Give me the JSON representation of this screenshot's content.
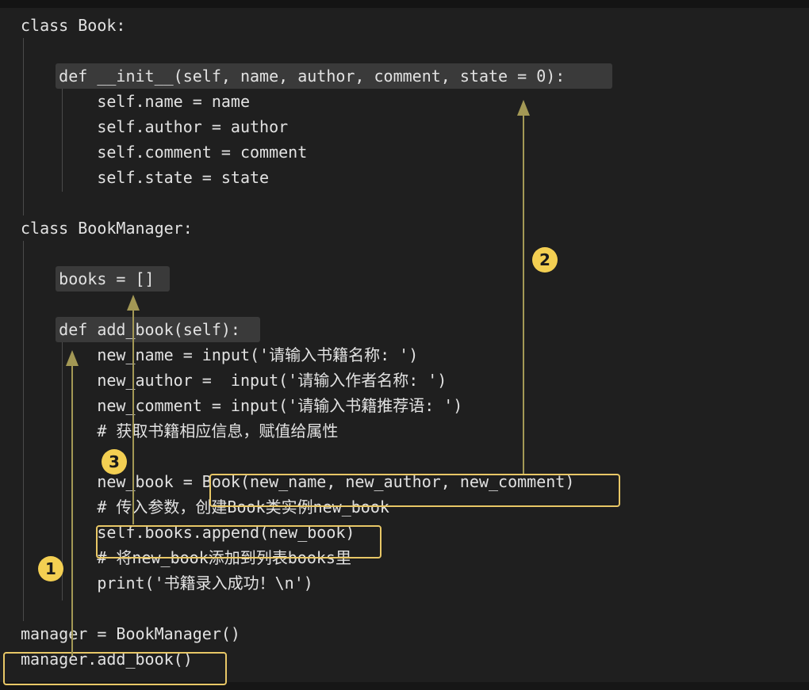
{
  "code": {
    "lines": [
      "class Book:",
      "    def __init__(self, name, author, comment, state = 0):",
      "        self.name = name",
      "        self.author = author",
      "        self.comment = comment",
      "        self.state = state",
      "class BookManager:",
      "    books = []",
      "    def add_book(self):",
      "        new_name = input('请输入书籍名称: ')",
      "        new_author =  input('请输入作者名称: ')",
      "        new_comment = input('请输入书籍推荐语: ')",
      "        # 获取书籍相应信息，赋值给属性",
      "        new_book = Book(new_name, new_author, new_comment)",
      "        # 传入参数，创建Book类实例new_book",
      "        self.books.append(new_book)",
      "        # 将new_book添加到列表books里",
      "        print('书籍录入成功！\\n')",
      "manager = BookManager()",
      "manager.add_book()"
    ]
  },
  "annotations": {
    "badges": [
      "1",
      "2",
      "3"
    ],
    "accent_color": "#e8c766",
    "arrow_color": "#a39855",
    "highlight_color": "#3a3a3a"
  }
}
